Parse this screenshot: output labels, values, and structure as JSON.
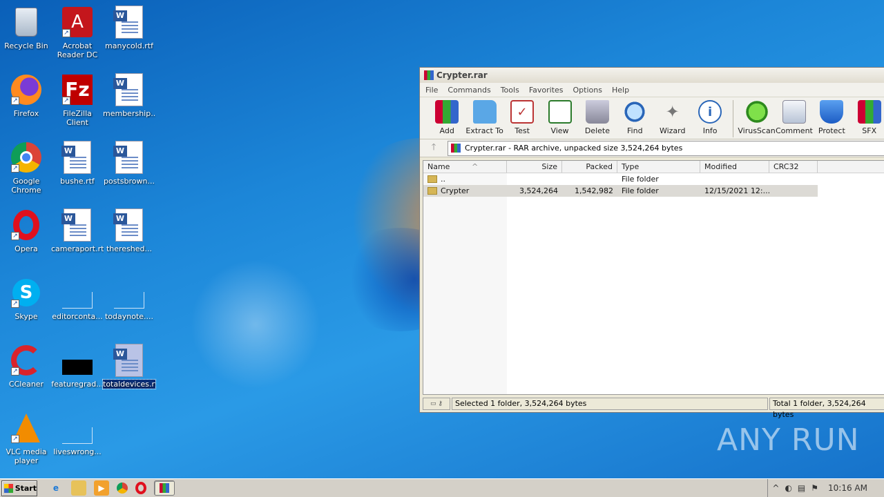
{
  "desktop": {
    "icons": [
      {
        "label": "Recycle Bin"
      },
      {
        "label": "Acrobat Reader DC"
      },
      {
        "label": "manycold.rtf"
      },
      {
        "label": "Firefox"
      },
      {
        "label": "FileZilla Client"
      },
      {
        "label": "membership..."
      },
      {
        "label": "Google Chrome"
      },
      {
        "label": "bushe.rtf"
      },
      {
        "label": "postsbrown..."
      },
      {
        "label": "Opera"
      },
      {
        "label": "cameraport.rtf"
      },
      {
        "label": "thereshed..."
      },
      {
        "label": "Skype"
      },
      {
        "label": "editorconta..."
      },
      {
        "label": "todaynote...."
      },
      {
        "label": "CCleaner"
      },
      {
        "label": "featuregrad..."
      },
      {
        "label": "totaldevices.rtf"
      },
      {
        "label": "VLC media player"
      },
      {
        "label": "liveswrong..."
      }
    ]
  },
  "window": {
    "title": "Crypter.rar",
    "menu": [
      "File",
      "Commands",
      "Tools",
      "Favorites",
      "Options",
      "Help"
    ],
    "toolbar": [
      "Add",
      "Extract To",
      "Test",
      "View",
      "Delete",
      "Find",
      "Wizard",
      "Info",
      "VirusScan",
      "Comment",
      "Protect",
      "SFX"
    ],
    "address": "Crypter.rar - RAR archive, unpacked size 3,524,264 bytes",
    "columns": [
      "Name",
      "Size",
      "Packed",
      "Type",
      "Modified",
      "CRC32"
    ],
    "rows": [
      {
        "name": "..",
        "size": "",
        "packed": "",
        "type": "File folder",
        "modified": "",
        "crc": ""
      },
      {
        "name": "Crypter",
        "size": "3,524,264",
        "packed": "1,542,982",
        "type": "File folder",
        "modified": "12/15/2021 12:...",
        "crc": ""
      }
    ],
    "status_left": "Selected 1 folder, 3,524,264 bytes",
    "status_right": "Total 1 folder, 3,524,264 bytes"
  },
  "taskbar": {
    "start_label": "Start",
    "clock": "10:16 AM"
  },
  "watermark": "ANY RUN",
  "colors": {
    "desktop_blue": "#1c86d8",
    "selection": "#0b2f78"
  }
}
